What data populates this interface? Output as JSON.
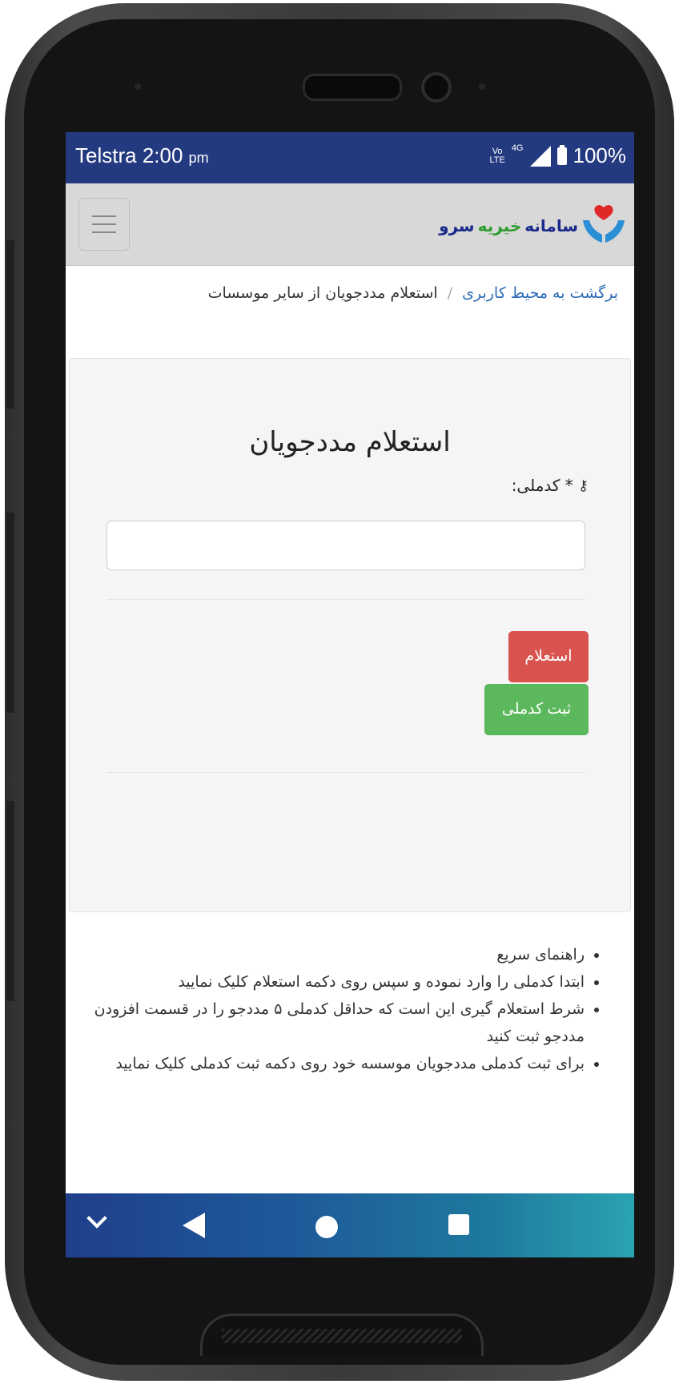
{
  "status_bar": {
    "carrier": "Telstra",
    "time": "2:00",
    "ampm": "pm",
    "volte_top": "Vo",
    "volte_bottom": "LTE",
    "network": "4G",
    "battery": "100%"
  },
  "header": {
    "logo_text_1": "سامانه",
    "logo_text_2": "خیریه",
    "logo_text_3": "سرو",
    "menu_icon": "hamburger-icon"
  },
  "breadcrumb": {
    "back_link": "برگشت به محیط کاربری",
    "separator": "/",
    "current": "استعلام مددجویان از سایر موسسات"
  },
  "form": {
    "title": "استعلام مددجویان",
    "field_label": "* کدملی:",
    "field_icon": "key-icon",
    "field_value": "",
    "inquiry_button": "استعلام",
    "register_button": "ثبت کدملی"
  },
  "guide": {
    "items": [
      "راهنمای سریع",
      "ابتدا کدملی را وارد نموده و سپس روی دکمه استعلام کلیک نمایید",
      "شرط استعلام گیری این است که حداقل کدملی ۵ مددجو را در قسمت افزودن مددجو ثبت کنید",
      "برای ثبت کدملی مددجویان موسسه خود روی دکمه ثبت کدملی کلیک نمایید"
    ]
  },
  "colors": {
    "status_bar": "#243a80",
    "navbar": "#d8d8d8",
    "danger": "#d9534f",
    "success": "#5cb85c",
    "link": "#2a6ab5"
  }
}
